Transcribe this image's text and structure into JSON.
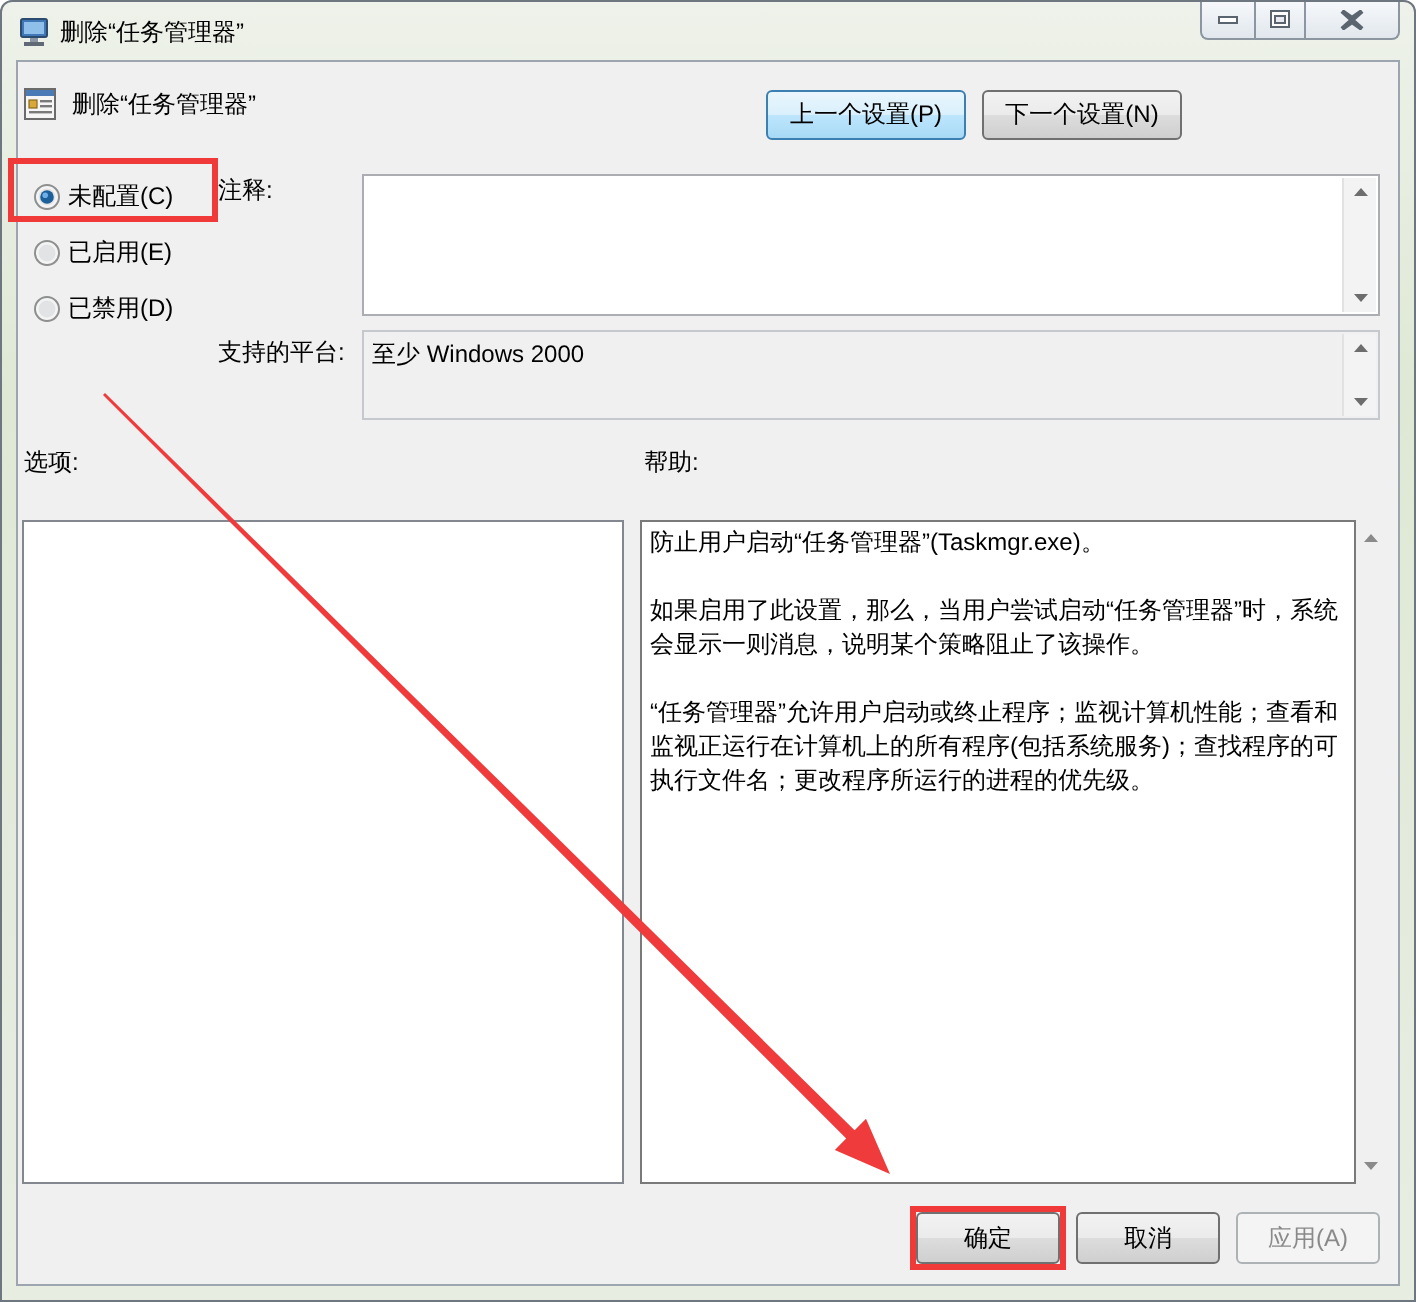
{
  "window": {
    "title": "删除“任务管理器”"
  },
  "header": {
    "title": "删除“任务管理器”"
  },
  "nav_buttons": [
    {
      "label": "上一个设置(P)",
      "focused": true
    },
    {
      "label": "下一个设置(N)",
      "focused": false
    }
  ],
  "state_options": [
    {
      "label": "未配置(C)",
      "selected": true,
      "highlighted": true
    },
    {
      "label": "已启用(E)",
      "selected": false,
      "highlighted": false
    },
    {
      "label": "已禁用(D)",
      "selected": false,
      "highlighted": false
    }
  ],
  "comment": {
    "label": "注释:"
  },
  "platform": {
    "label": "支持的平台:",
    "value": "至少 Windows 2000"
  },
  "options": {
    "label": "选项:"
  },
  "help": {
    "label": "帮助:",
    "paragraphs": [
      "防止用户启动“任务管理器”(Taskmgr.exe)。",
      "如果启用了此设置，那么，当用户尝试启动“任务管理器”时，系统会显示一则消息，说明某个策略阻止了该操作。",
      "“任务管理器”允许用户启动或终止程序；监视计算机性能；查看和监视正运行在计算机上的所有程序(包括系统服务)；查找程序的可执行文件名；更改程序所运行的进程的优先级。"
    ]
  },
  "buttons": [
    {
      "label": "确定",
      "highlighted": true,
      "disabled": false
    },
    {
      "label": "取消",
      "highlighted": false,
      "disabled": false
    },
    {
      "label": "应用(A)",
      "highlighted": false,
      "disabled": true
    }
  ],
  "annotations": {
    "arrow": true
  }
}
